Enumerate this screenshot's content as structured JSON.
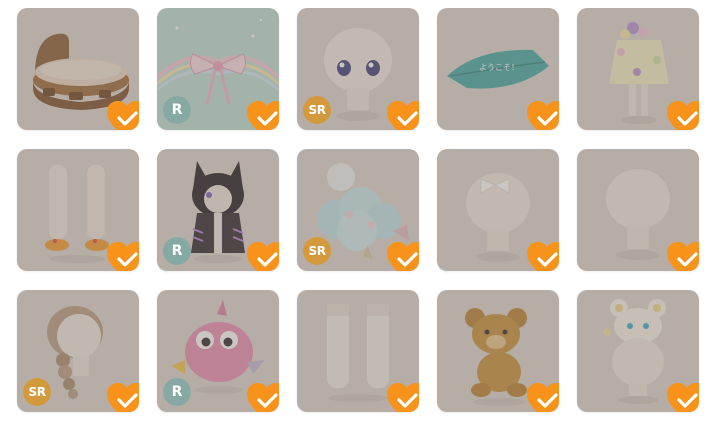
{
  "items": [
    {
      "icon": "round-bed-icon",
      "rarity": "",
      "owned": true,
      "bg": "gray"
    },
    {
      "icon": "ribbon-bow-icon",
      "rarity": "R",
      "owned": true,
      "bg": "teal"
    },
    {
      "icon": "face-eyes-icon",
      "rarity": "SR",
      "owned": true,
      "bg": "gray"
    },
    {
      "icon": "leaf-sign-icon",
      "rarity": "",
      "owned": true,
      "bg": "gray",
      "sign_text": "ようこそ！"
    },
    {
      "icon": "flower-dress-icon",
      "rarity": "",
      "owned": true,
      "bg": "gray"
    },
    {
      "icon": "socks-shoes-icon",
      "rarity": "",
      "owned": true,
      "bg": "gray"
    },
    {
      "icon": "cat-hood-outfit-icon",
      "rarity": "R",
      "owned": true,
      "bg": "gray"
    },
    {
      "icon": "cloud-hat-icon",
      "rarity": "SR",
      "owned": true,
      "bg": "gray"
    },
    {
      "icon": "hair-bow-icon",
      "rarity": "",
      "owned": true,
      "bg": "gray"
    },
    {
      "icon": "head-silhouette-icon",
      "rarity": "",
      "owned": true,
      "bg": "gray"
    },
    {
      "icon": "braid-hair-icon",
      "rarity": "SR",
      "owned": true,
      "bg": "gray"
    },
    {
      "icon": "pink-monster-icon",
      "rarity": "R",
      "owned": true,
      "bg": "gray"
    },
    {
      "icon": "white-socks-icon",
      "rarity": "",
      "owned": true,
      "bg": "gray"
    },
    {
      "icon": "teddy-bear-icon",
      "rarity": "",
      "owned": true,
      "bg": "gray"
    },
    {
      "icon": "bear-ears-hat-icon",
      "rarity": "",
      "owned": true,
      "bg": "gray"
    }
  ],
  "colors": {
    "owned_badge": "#f7931a",
    "rarity_R": "#86a9a4",
    "rarity_SR": "#d39a3d"
  }
}
